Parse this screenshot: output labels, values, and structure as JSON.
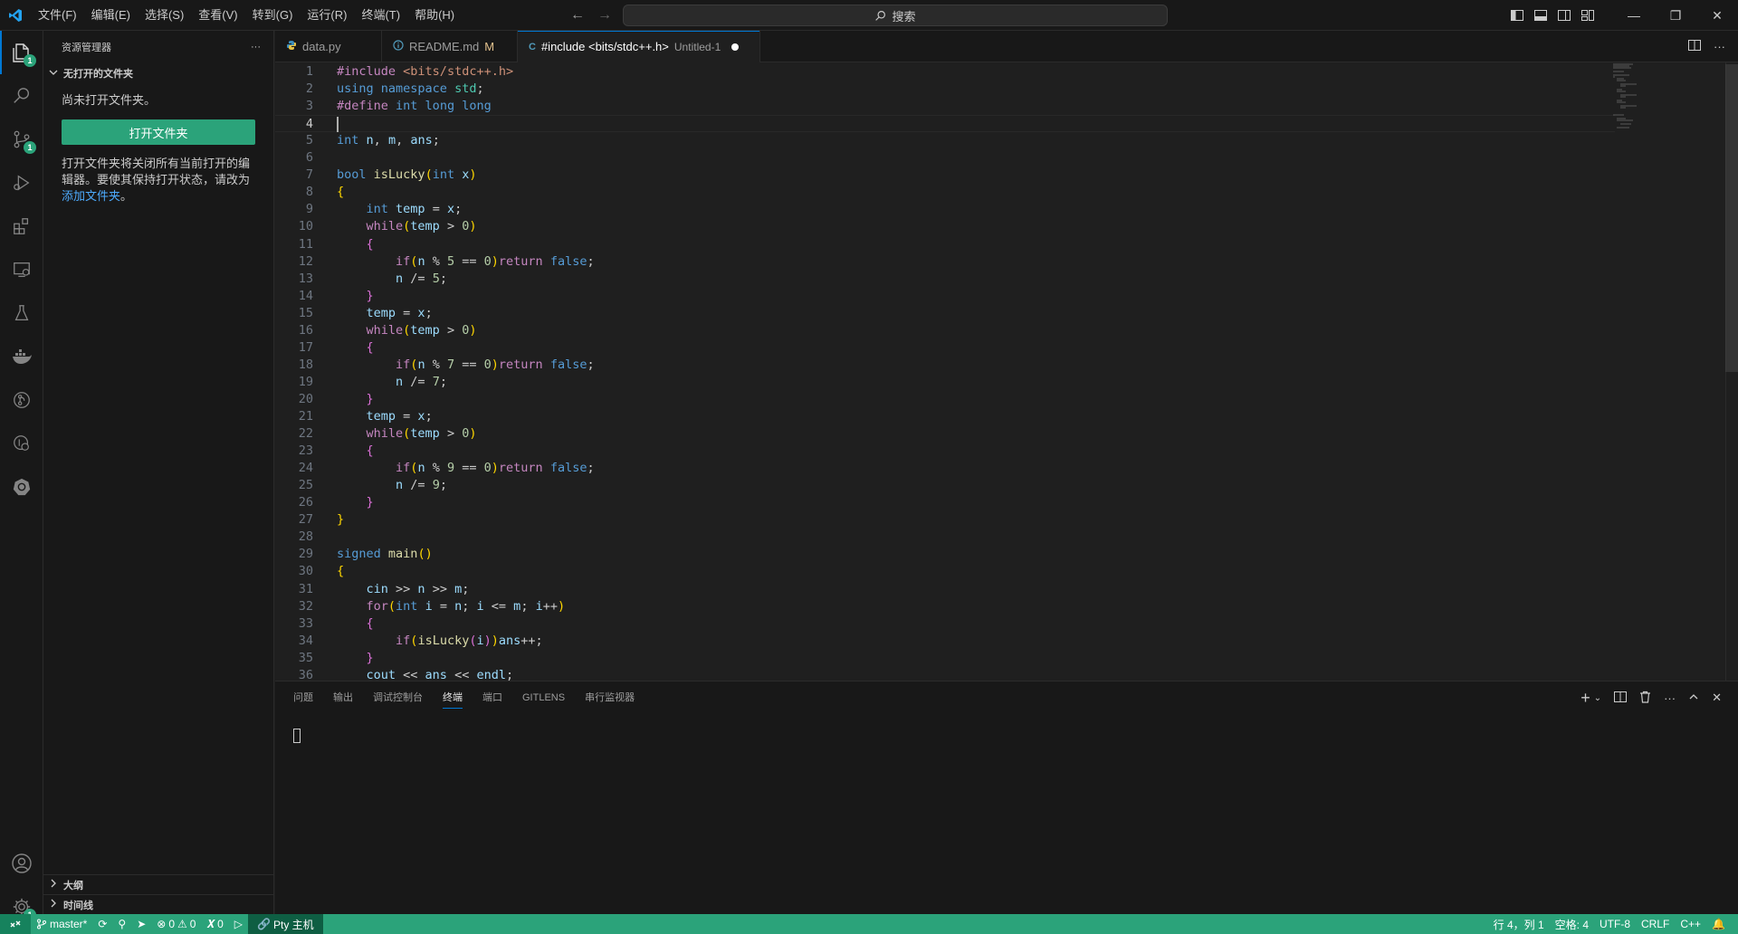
{
  "menu": [
    "文件(F)",
    "编辑(E)",
    "选择(S)",
    "查看(V)",
    "转到(G)",
    "运行(R)",
    "终端(T)",
    "帮助(H)"
  ],
  "search": {
    "label": "搜索"
  },
  "sidebar": {
    "title": "资源管理器",
    "more": "···",
    "section": "无打开的文件夹",
    "no_folder_text": "尚未打开文件夹。",
    "open_button": "打开文件夹",
    "hint_text": "打开文件夹将关闭所有当前打开的编辑器。要使其保持打开状态，请改为",
    "hint_link": "添加文件夹",
    "hint_end": "。",
    "outline": "大纲",
    "timeline": "时间线"
  },
  "activity_badges": {
    "explorer": "1",
    "scm": "1",
    "settings": "1"
  },
  "tabs": [
    {
      "label": "data.py",
      "modified": "",
      "description": ""
    },
    {
      "label": "README.md",
      "modified": "M",
      "description": ""
    },
    {
      "label": "#include <bits/stdc++.h>",
      "modified": "",
      "description": "Untitled-1"
    }
  ],
  "editor": {
    "current_line": 4,
    "lines": [
      "#include <bits/stdc++.h>",
      "using namespace std;",
      "#define int long long",
      "",
      "int n, m, ans;",
      "",
      "bool isLucky(int x)",
      "{",
      "    int temp = x;",
      "    while(temp > 0)",
      "    {",
      "        if(n % 5 == 0)return false;",
      "        n /= 5;",
      "    }",
      "    temp = x;",
      "    while(temp > 0)",
      "    {",
      "        if(n % 7 == 0)return false;",
      "        n /= 7;",
      "    }",
      "    temp = x;",
      "    while(temp > 0)",
      "    {",
      "        if(n % 9 == 0)return false;",
      "        n /= 9;",
      "    }",
      "}",
      "",
      "signed main()",
      "{",
      "    cin >> n >> m;",
      "    for(int i = n; i <= m; i++)",
      "    {",
      "        if(isLucky(i))ans++;",
      "    }",
      "    cout << ans << endl;"
    ]
  },
  "panel": {
    "tabs": [
      "问题",
      "输出",
      "调试控制台",
      "终端",
      "端口",
      "GITLENS",
      "串行监视器"
    ],
    "active_tab": "终端"
  },
  "status": {
    "branch": "master*",
    "errors": "0",
    "warnings": "0",
    "ports": "0",
    "host": "Pty 主机",
    "position": "行 4，列 1",
    "spaces": "空格: 4",
    "encoding": "UTF-8",
    "eol": "CRLF",
    "language": "C++"
  },
  "colors": {
    "accent": "#2ba37a",
    "focus": "#0078d4",
    "modified": "#e2c08d"
  }
}
